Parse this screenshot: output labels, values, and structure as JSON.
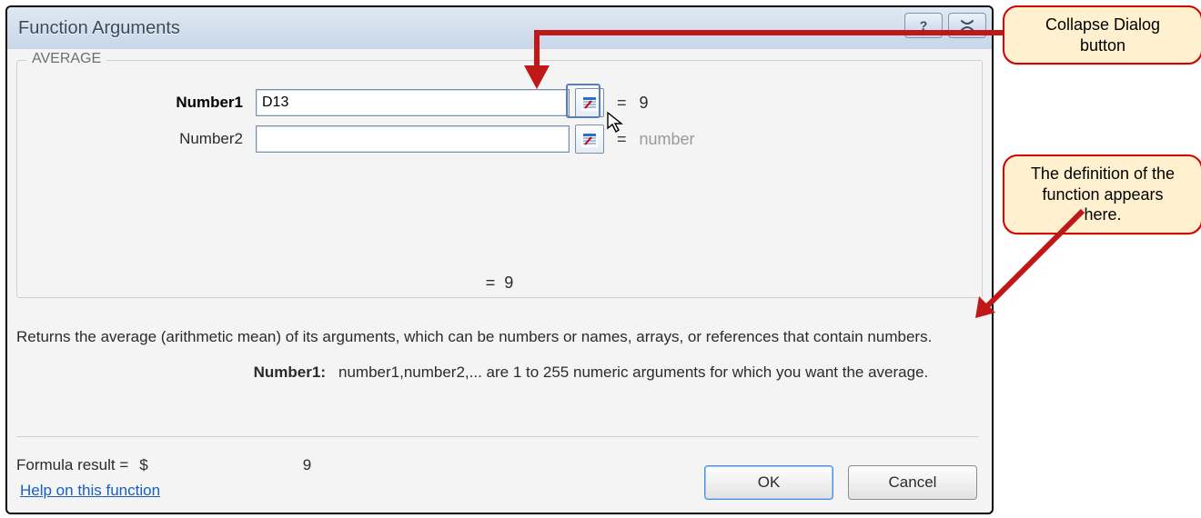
{
  "dialog": {
    "title": "Function Arguments",
    "help_btn_tooltip": "Help",
    "close_btn_tooltip": "Close"
  },
  "group": {
    "function_name": "AVERAGE",
    "args": [
      {
        "label": "Number1",
        "value": "D13",
        "result": "9",
        "bold": true
      },
      {
        "label": "Number2",
        "value": "",
        "result": "number",
        "bold": false,
        "gray_result": true
      }
    ],
    "mid_equals": "=",
    "mid_value": "9"
  },
  "description": "Returns the average (arithmetic mean) of its arguments, which can be numbers or names, arrays, or references that contain numbers.",
  "arg_description": {
    "label": "Number1:",
    "text": "number1,number2,... are 1 to 255 numeric arguments for which you want the average."
  },
  "formula_result": {
    "label": "Formula result =",
    "currency": "$",
    "value": "9"
  },
  "help_link": "Help on this function",
  "buttons": {
    "ok": "OK",
    "cancel": "Cancel"
  },
  "callouts": {
    "collapse": "Collapse Dialog button",
    "definition": "The definition of the function appears here."
  }
}
